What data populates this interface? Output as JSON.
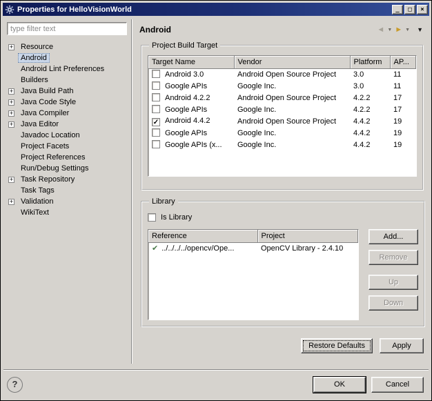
{
  "window": {
    "title": "Properties for HelloVisionWorld",
    "minimize_label": "_",
    "maximize_label": "□",
    "close_label": "×"
  },
  "sidebar": {
    "filter_placeholder": "type filter text",
    "tree": [
      {
        "label": "Resource",
        "expandable": true,
        "selected": false
      },
      {
        "label": "Android",
        "expandable": false,
        "selected": true
      },
      {
        "label": "Android Lint Preferences",
        "expandable": false,
        "selected": false
      },
      {
        "label": "Builders",
        "expandable": false,
        "selected": false
      },
      {
        "label": "Java Build Path",
        "expandable": true,
        "selected": false
      },
      {
        "label": "Java Code Style",
        "expandable": true,
        "selected": false
      },
      {
        "label": "Java Compiler",
        "expandable": true,
        "selected": false
      },
      {
        "label": "Java Editor",
        "expandable": true,
        "selected": false
      },
      {
        "label": "Javadoc Location",
        "expandable": false,
        "selected": false
      },
      {
        "label": "Project Facets",
        "expandable": false,
        "selected": false
      },
      {
        "label": "Project References",
        "expandable": false,
        "selected": false
      },
      {
        "label": "Run/Debug Settings",
        "expandable": false,
        "selected": false
      },
      {
        "label": "Task Repository",
        "expandable": true,
        "selected": false
      },
      {
        "label": "Task Tags",
        "expandable": false,
        "selected": false
      },
      {
        "label": "Validation",
        "expandable": true,
        "selected": false
      },
      {
        "label": "WikiText",
        "expandable": false,
        "selected": false
      }
    ]
  },
  "header": {
    "title": "Android"
  },
  "build_target": {
    "group_label": "Project Build Target",
    "columns": [
      "Target Name",
      "Vendor",
      "Platform",
      "AP..."
    ],
    "rows": [
      {
        "checked": false,
        "target_name": "Android 3.0",
        "vendor": "Android Open Source Project",
        "platform": "3.0",
        "api_level": "11"
      },
      {
        "checked": false,
        "target_name": "Google APIs",
        "vendor": "Google Inc.",
        "platform": "3.0",
        "api_level": "11"
      },
      {
        "checked": false,
        "target_name": "Android 4.2.2",
        "vendor": "Android Open Source Project",
        "platform": "4.2.2",
        "api_level": "17"
      },
      {
        "checked": false,
        "target_name": "Google APIs",
        "vendor": "Google Inc.",
        "platform": "4.2.2",
        "api_level": "17"
      },
      {
        "checked": true,
        "target_name": "Android 4.4.2",
        "vendor": "Android Open Source Project",
        "platform": "4.4.2",
        "api_level": "19"
      },
      {
        "checked": false,
        "target_name": "Google APIs",
        "vendor": "Google Inc.",
        "platform": "4.4.2",
        "api_level": "19"
      },
      {
        "checked": false,
        "target_name": "Google APIs (x...",
        "vendor": "Google Inc.",
        "platform": "4.4.2",
        "api_level": "19"
      }
    ]
  },
  "library": {
    "group_label": "Library",
    "is_library_label": "Is Library",
    "is_library_checked": false,
    "columns": [
      "Reference",
      "Project"
    ],
    "rows": [
      {
        "reference": "../../../../opencv/Ope...",
        "project": "OpenCV Library - 2.4.10"
      }
    ],
    "buttons": [
      {
        "label": "Add...",
        "enabled": true,
        "name": "add-button"
      },
      {
        "label": "Remove",
        "enabled": false,
        "name": "remove-button"
      },
      {
        "label": "Up",
        "enabled": false,
        "name": "up-button"
      },
      {
        "label": "Down",
        "enabled": false,
        "name": "down-button"
      }
    ]
  },
  "actions": {
    "restore_defaults": "Restore Defaults",
    "apply": "Apply",
    "ok": "OK",
    "cancel": "Cancel",
    "help": "?"
  }
}
